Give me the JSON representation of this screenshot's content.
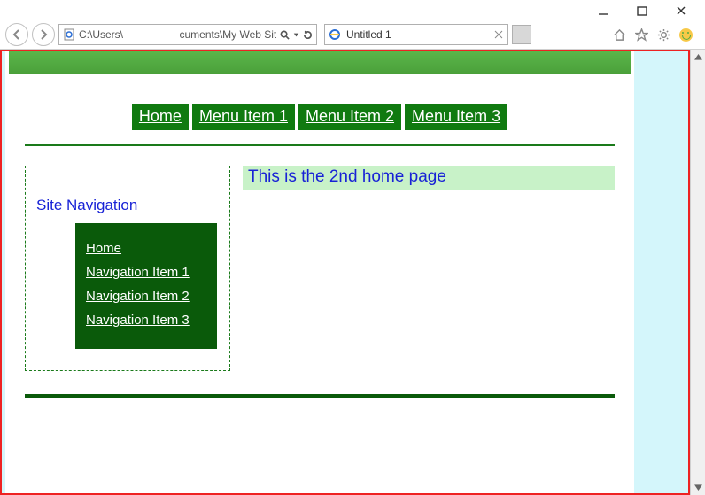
{
  "browser": {
    "address_left": "C:\\Users\\",
    "address_right": "cuments\\My Web Sites\\",
    "tab_title": "Untitled 1"
  },
  "page": {
    "topnav": {
      "home": "Home",
      "items": [
        "Menu Item 1",
        "Menu Item 2",
        "Menu Item 3"
      ]
    },
    "sidebar": {
      "heading": "Site Navigation",
      "home": "Home",
      "items": [
        "Navigation Item 1",
        "Navigation Item 2",
        "Navigation Item 3"
      ]
    },
    "content": {
      "headline": "This is the 2nd home page"
    }
  }
}
